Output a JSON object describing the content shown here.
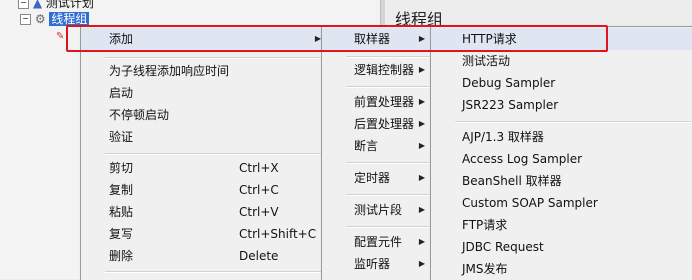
{
  "tree": {
    "test_plan": "测试计划",
    "thread_group": "线程组"
  },
  "panel": {
    "title": "线程组"
  },
  "menu_main": {
    "add": "添加",
    "add_think_time": "为子线程添加响应时间",
    "start": "启动",
    "start_no_pauses": "不停顿启动",
    "validate": "验证",
    "cut": "剪切",
    "cut_shortcut": "Ctrl+X",
    "copy": "复制",
    "copy_shortcut": "Ctrl+C",
    "paste": "粘贴",
    "paste_shortcut": "Ctrl+V",
    "duplicate": "复写",
    "duplicate_shortcut": "Ctrl+Shift+C",
    "delete": "删除",
    "delete_shortcut": "Delete"
  },
  "menu_add": {
    "sampler": "取样器",
    "logic_controller": "逻辑控制器",
    "pre_processor": "前置处理器",
    "post_processor": "后置处理器",
    "assertion": "断言",
    "timer": "定时器",
    "test_fragment": "测试片段",
    "config_element": "配置元件",
    "listener": "监听器"
  },
  "menu_sampler": {
    "items": [
      "HTTP请求",
      "测试活动",
      "Debug Sampler",
      "JSR223 Sampler",
      "AJP/1.3 取样器",
      "Access Log Sampler",
      "BeanShell 取样器",
      "Custom SOAP Sampler",
      "FTP请求",
      "JDBC Request",
      "JMS发布"
    ]
  },
  "colors": {
    "highlight_border": "#e0141d",
    "selection": "#2f6fd1",
    "menu_bg": "#f0f0f0"
  }
}
